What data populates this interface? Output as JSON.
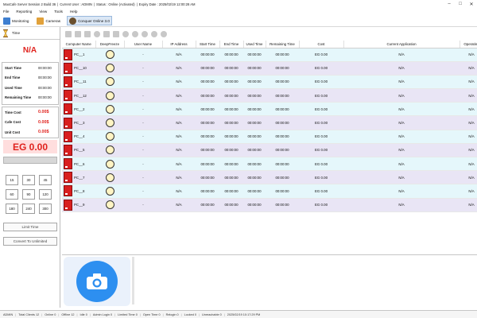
{
  "titlebar": {
    "app_title": "MaxCafe Server Session 2 Build 36",
    "current_user": "Current User : ADMIN",
    "status": "Status : Online (Activated)",
    "expiry": "Expiry Date : 2025/02/19 12:00:28 AM"
  },
  "menu": [
    "File",
    "Reporting",
    "View",
    "Tools",
    "Help"
  ],
  "tabs": [
    "Monitoring",
    "Cameras",
    "Conquer Online 3.0"
  ],
  "left": {
    "time_label": "Time",
    "na": "N/A",
    "times": [
      {
        "label": "Start Time",
        "value": "00:00:00"
      },
      {
        "label": "End Time",
        "value": "00:00:00"
      },
      {
        "label": "Used Time",
        "value": "00:00:00"
      },
      {
        "label": "Remaining Time",
        "value": "00:00:00"
      }
    ],
    "costs": [
      {
        "label": "Time Cost",
        "value": "0.00$"
      },
      {
        "label": "Cafe Cost",
        "value": "0.00$"
      },
      {
        "label": "Unit Cost",
        "value": "0.00$"
      }
    ],
    "total": "EG 0.00",
    "minutes": [
      "15",
      "30",
      "45",
      "60",
      "90",
      "120",
      "180",
      "240",
      "300"
    ],
    "limit_time": "Limit Time",
    "convert": "Convert To Unlimited"
  },
  "grid": {
    "columns": [
      "Computer Name",
      "DeepFreeze",
      "User Name",
      "IP Address",
      "Start Time",
      "End Time",
      "Used Time",
      "Remaining Time",
      "Cost",
      "Current Application",
      "Operating"
    ],
    "rows": [
      {
        "name": "PC__1",
        "user": "-",
        "ip": "N/A",
        "start": "00:00:00",
        "end": "00:00:00",
        "used": "00:00:00",
        "rem": "00:00:00",
        "cost": "EG 0.00",
        "app": "N/A",
        "os": "N/A"
      },
      {
        "name": "PC__10",
        "user": "-",
        "ip": "N/A",
        "start": "00:00:00",
        "end": "00:00:00",
        "used": "00:00:00",
        "rem": "00:00:00",
        "cost": "EG 0.00",
        "app": "N/A",
        "os": "N/A"
      },
      {
        "name": "PC__11",
        "user": "-",
        "ip": "N/A",
        "start": "00:00:00",
        "end": "00:00:00",
        "used": "00:00:00",
        "rem": "00:00:00",
        "cost": "EG 0.00",
        "app": "N/A",
        "os": "N/A"
      },
      {
        "name": "PC__12",
        "user": "-",
        "ip": "N/A",
        "start": "00:00:00",
        "end": "00:00:00",
        "used": "00:00:00",
        "rem": "00:00:00",
        "cost": "EG 0.00",
        "app": "N/A",
        "os": "N/A"
      },
      {
        "name": "PC__2",
        "user": "-",
        "ip": "N/A",
        "start": "00:00:00",
        "end": "00:00:00",
        "used": "00:00:00",
        "rem": "00:00:00",
        "cost": "EG 0.00",
        "app": "N/A",
        "os": "N/A"
      },
      {
        "name": "PC__3",
        "user": "-",
        "ip": "N/A",
        "start": "00:00:00",
        "end": "00:00:00",
        "used": "00:00:00",
        "rem": "00:00:00",
        "cost": "EG 0.00",
        "app": "N/A",
        "os": "N/A"
      },
      {
        "name": "PC__4",
        "user": "-",
        "ip": "N/A",
        "start": "00:00:00",
        "end": "00:00:00",
        "used": "00:00:00",
        "rem": "00:00:00",
        "cost": "EG 0.00",
        "app": "N/A",
        "os": "N/A"
      },
      {
        "name": "PC__5",
        "user": "-",
        "ip": "N/A",
        "start": "00:00:00",
        "end": "00:00:00",
        "used": "00:00:00",
        "rem": "00:00:00",
        "cost": "EG 0.00",
        "app": "N/A",
        "os": "N/A"
      },
      {
        "name": "PC__6",
        "user": "-",
        "ip": "N/A",
        "start": "00:00:00",
        "end": "00:00:00",
        "used": "00:00:00",
        "rem": "00:00:00",
        "cost": "EG 0.00",
        "app": "N/A",
        "os": "N/A"
      },
      {
        "name": "PC__7",
        "user": "-",
        "ip": "N/A",
        "start": "00:00:00",
        "end": "00:00:00",
        "used": "00:00:00",
        "rem": "00:00:00",
        "cost": "EG 0.00",
        "app": "N/A",
        "os": "N/A"
      },
      {
        "name": "PC__8",
        "user": "-",
        "ip": "N/A",
        "start": "00:00:00",
        "end": "00:00:00",
        "used": "00:00:00",
        "rem": "00:00:00",
        "cost": "EG 0.00",
        "app": "N/A",
        "os": "N/A"
      },
      {
        "name": "PC__9",
        "user": "-",
        "ip": "N/A",
        "start": "00:00:00",
        "end": "00:00:00",
        "used": "00:00:00",
        "rem": "00:00:00",
        "cost": "EG 0.00",
        "app": "N/A",
        "os": "N/A"
      }
    ]
  },
  "status": [
    "ADMIN",
    "Total Clients 12",
    "Online 0",
    "Offline 12",
    "Idle 0",
    "Admin Login 0",
    "Limited Time 0",
    "Open Time 0",
    "Relogin 0",
    "Locked 0",
    "Unreachable 0",
    "2025/02/19 10:17:29 PM"
  ],
  "colors": {
    "accent_red": "#e0231e",
    "row_a": "#e5f7fb",
    "row_b": "#e9e5f5",
    "camera_blue": "#2d8ff0"
  }
}
